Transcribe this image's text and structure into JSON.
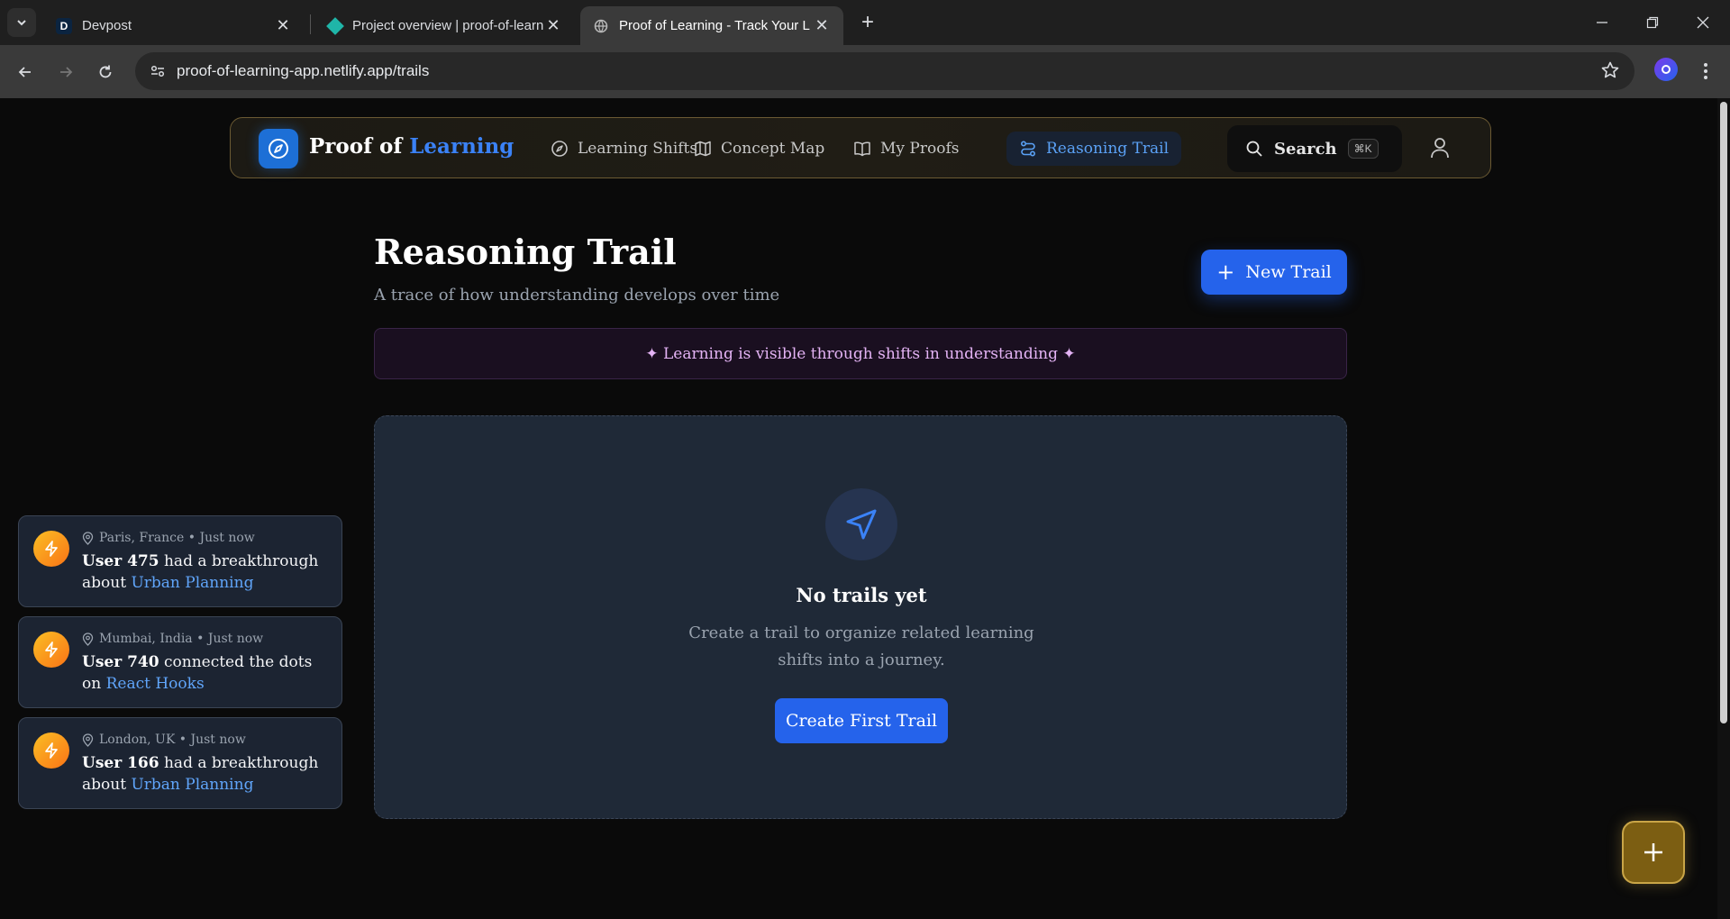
{
  "browser": {
    "tabs": [
      {
        "title": "Devpost",
        "favicon": "D"
      },
      {
        "title": "Project overview | proof-of-learn",
        "favicon": "diamond"
      },
      {
        "title": "Proof of Learning - Track Your L",
        "favicon": "globe",
        "active": true
      }
    ],
    "url": "proof-of-learning-app.netlify.app/trails"
  },
  "navbar": {
    "brand_prefix": "Proof of",
    "brand_accent": "Learning",
    "items": [
      {
        "label": "Learning Shifts",
        "icon": "compass-icon"
      },
      {
        "label": "Concept Map",
        "icon": "map-icon"
      },
      {
        "label": "My Proofs",
        "icon": "book-icon"
      },
      {
        "label": "Reasoning Trail",
        "icon": "route-icon",
        "active": true
      }
    ],
    "search_label": "Search",
    "search_shortcut": "⌘K"
  },
  "main": {
    "title": "Reasoning Trail",
    "subtitle": "A trace of how understanding develops over time",
    "new_trail_label": "New Trail",
    "banner": "✦ Learning is visible through shifts in understanding ✦",
    "empty": {
      "title": "No trails yet",
      "description": "Create a trail to organize related learning shifts into a journey.",
      "button": "Create First Trail"
    }
  },
  "toasts": [
    {
      "location": "Paris, France",
      "time": "Just now",
      "user": "User 475",
      "action": "had a breakthrough about",
      "topic": "Urban Planning"
    },
    {
      "location": "Mumbai, India",
      "time": "Just now",
      "user": "User 740",
      "action": "connected the dots on",
      "topic": "React Hooks"
    },
    {
      "location": "London, UK",
      "time": "Just now",
      "user": "User 166",
      "action": "had a breakthrough about",
      "topic": "Urban Planning"
    }
  ],
  "colors": {
    "accent": "#2563eb",
    "brand_accent": "#3b82f6",
    "nav_active": "#5aa1f5",
    "banner_text": "#e4b3f5",
    "fab": "#7c5e12"
  }
}
